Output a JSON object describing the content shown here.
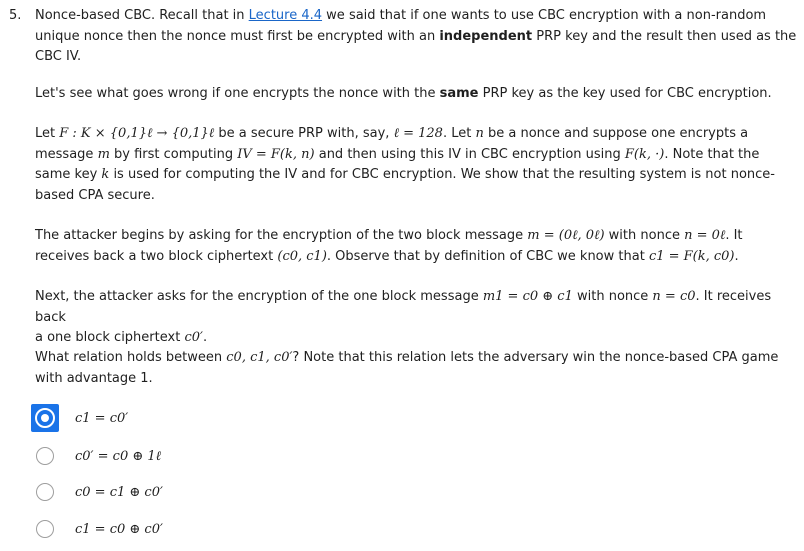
{
  "question": {
    "number": "5.",
    "p1": {
      "a": "Nonce-based CBC. Recall that in ",
      "link": "Lecture 4.4",
      "b": " we said that if one wants to use CBC encryption with a non-random",
      "line2a": "unique nonce then the nonce must first be encrypted with an ",
      "bold": "independent",
      "line2b": " PRP key and the result then used as the",
      "line3": "CBC IV."
    },
    "p2": {
      "a": "Let's see what goes wrong if one encrypts the nonce with the ",
      "bold": "same",
      "b": " PRP key as the key used for CBC encryption."
    },
    "p3": {
      "l1a": "Let ",
      "l1math": "F : K × {0,1}ℓ → {0,1}ℓ",
      "l1b": " be a secure PRP with, say, ",
      "l1math2": "ℓ = 128",
      "l1c": ". Let ",
      "l1n": "n",
      "l1d": " be a nonce and suppose one encrypts a",
      "l2a": "message ",
      "l2m": "m",
      "l2b": " by first computing ",
      "l2math": "IV = F(k, n)",
      "l2c": " and then using this IV in CBC encryption using ",
      "l2math2": "F(k, ·)",
      "l2d": ". Note that the",
      "l3a": "same key ",
      "l3k": "k",
      "l3b": " is used for computing the IV and for CBC encryption. We show that the resulting system is not nonce-",
      "l4": "based CPA secure."
    },
    "p4": {
      "l1a": "The attacker begins by asking for the encryption of the two block message ",
      "l1math": "m = (0ℓ, 0ℓ)",
      "l1b": " with nonce ",
      "l1math2": "n = 0ℓ",
      "l1c": ". It",
      "l2a": "receives back a two block ciphertext ",
      "l2math": "(c0, c1)",
      "l2b": ". Observe that by definition of CBC we know that ",
      "l2math2": "c1 = F(k, c0)",
      "l2c": "."
    },
    "p5": {
      "l1a": "Next, the attacker asks for the encryption of the one block message ",
      "l1math": "m1 = c0 ⊕ c1",
      "l1b": " with nonce ",
      "l1math2": "n = c0",
      "l1c": ". It receives back",
      "l2a": "a one block ciphertext ",
      "l2math": "c0′",
      "l2b": "."
    },
    "p6": {
      "l1a": "What relation holds between ",
      "l1math": "c0, c1, c0′",
      "l1b": "? Note that this relation lets the adversary win the nonce-based CPA game",
      "l2": "with advantage 1."
    },
    "options": [
      {
        "label": "c1 = c0′",
        "selected": true
      },
      {
        "label": "c0′ = c0 ⊕ 1ℓ",
        "selected": false
      },
      {
        "label": "c0 = c1 ⊕ c0′",
        "selected": false
      },
      {
        "label": "c1 = c0 ⊕ c0′",
        "selected": false
      }
    ],
    "accent_color": "#1a73e8",
    "link_color": "#1a66c8"
  }
}
